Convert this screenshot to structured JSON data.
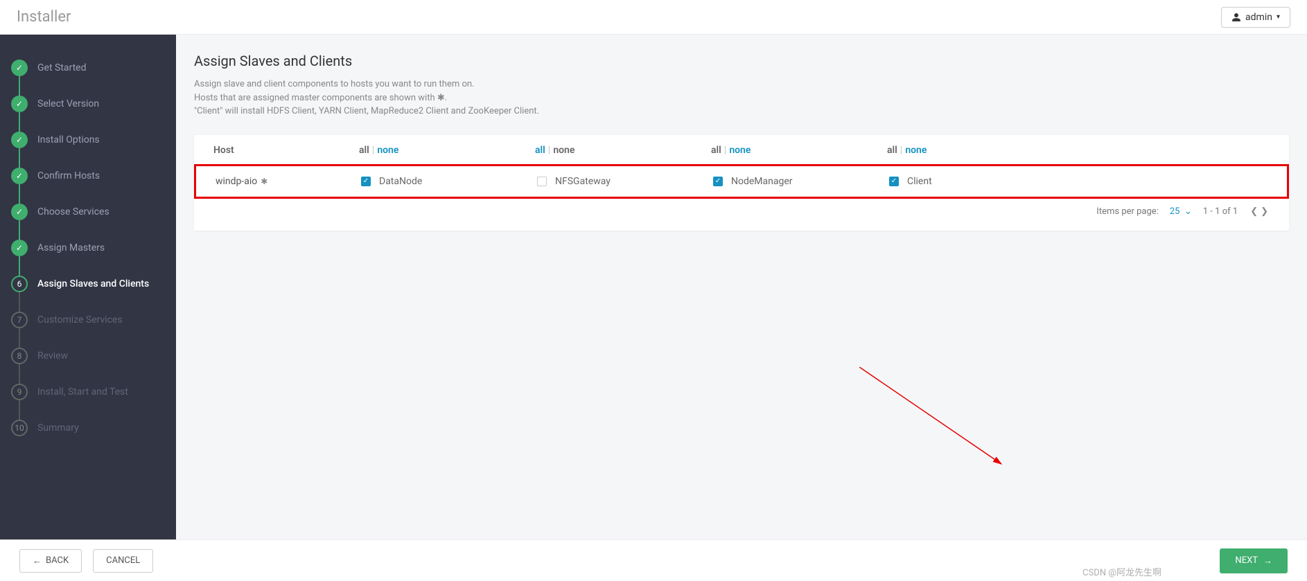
{
  "header": {
    "title": "Installer",
    "user": "admin"
  },
  "sidebar": {
    "steps": [
      {
        "label": "Get Started",
        "state": "done"
      },
      {
        "label": "Select Version",
        "state": "done"
      },
      {
        "label": "Install Options",
        "state": "done"
      },
      {
        "label": "Confirm Hosts",
        "state": "done"
      },
      {
        "label": "Choose Services",
        "state": "done"
      },
      {
        "label": "Assign Masters",
        "state": "done"
      },
      {
        "label": "Assign Slaves and Clients",
        "state": "current",
        "num": "6"
      },
      {
        "label": "Customize Services",
        "state": "future",
        "num": "7"
      },
      {
        "label": "Review",
        "state": "future",
        "num": "8"
      },
      {
        "label": "Install, Start and Test",
        "state": "future",
        "num": "9"
      },
      {
        "label": "Summary",
        "state": "future",
        "num": "10"
      }
    ]
  },
  "page": {
    "title": "Assign Slaves and Clients",
    "desc1": "Assign slave and client components to hosts you want to run them on.",
    "desc2_a": "Hosts that are assigned master components are shown with ",
    "desc2_b": ".",
    "desc3": "\"Client\" will install HDFS Client, YARN Client, MapReduce2 Client and ZooKeeper Client."
  },
  "table": {
    "host_header": "Host",
    "all": "all",
    "none": "none",
    "columns": [
      {
        "label": "DataNode",
        "active_link": "none"
      },
      {
        "label": "NFSGateway",
        "active_link": "all"
      },
      {
        "label": "NodeManager",
        "active_link": "none"
      },
      {
        "label": "Client",
        "active_link": "none"
      }
    ],
    "rows": [
      {
        "host": "windp-aio",
        "has_master": true,
        "cells": [
          {
            "checked": true
          },
          {
            "checked": false
          },
          {
            "checked": true
          },
          {
            "checked": true
          }
        ]
      }
    ]
  },
  "pager": {
    "items_label": "Items per page:",
    "per_page": "25",
    "range": "1 - 1 of 1"
  },
  "footer": {
    "back": "BACK",
    "cancel": "CANCEL",
    "next": "NEXT"
  },
  "watermark": "CSDN @阿龙先生啊"
}
